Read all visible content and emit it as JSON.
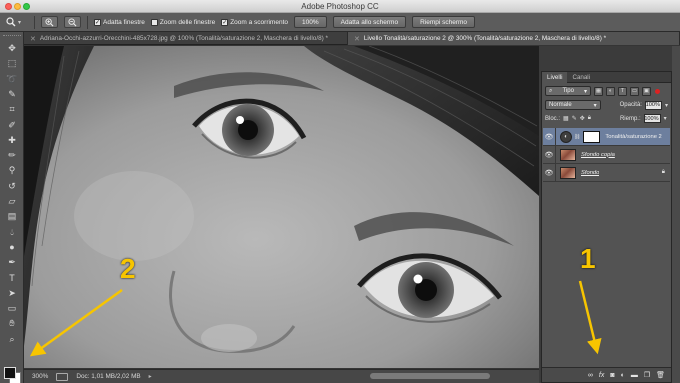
{
  "window": {
    "title": "Adobe Photoshop CC"
  },
  "options_bar": {
    "tool_icon": "zoom-icon",
    "zoom_in_icon": "zoom-in-icon",
    "zoom_out_icon": "zoom-out-icon",
    "checkboxes": [
      {
        "label": "Adatta finestre",
        "checked": true
      },
      {
        "label": "Zoom delle finestre",
        "checked": false
      },
      {
        "label": "Zoom a scorrimento",
        "checked": true
      }
    ],
    "buttons": [
      "100%",
      "Adatta allo schermo",
      "Riempi schermo"
    ]
  },
  "document_tabs": [
    {
      "label": "Adriana-Occhi-azzurri-Orecchini-485x728.jpg @ 100% (Tonalità/saturazione 2, Maschera di livello/8) *",
      "active": false
    },
    {
      "label": "Livello Tonalità/saturazione 2 @ 300% (Tonalità/saturazione 2, Maschera di livello/8) *",
      "active": true
    }
  ],
  "status_bar": {
    "zoom": "300%",
    "doc": "Doc: 1,01 MB/2,02 MB"
  },
  "layers_panel": {
    "tabs": [
      "Livelli",
      "Canali"
    ],
    "filter_label": "Tipo",
    "blend_mode": "Normale",
    "opacity_label": "Opacità:",
    "opacity_value": "100%",
    "lock_label": "Bloc.:",
    "fill_label": "Riemp.:",
    "fill_value": "100%",
    "layers": [
      {
        "name": "Tonalità/saturazione 2",
        "selected": true,
        "type": "adjustment"
      },
      {
        "name": "Sfondo copia",
        "selected": false,
        "type": "photo"
      },
      {
        "name": "Sfondo",
        "selected": false,
        "type": "photo",
        "locked": true
      }
    ],
    "footer_icons": [
      "link-icon",
      "fx-icon",
      "mask-icon",
      "adjustment-icon",
      "folder-icon",
      "new-layer-icon",
      "trash-icon"
    ],
    "footer_fx": "fx"
  },
  "annotations": {
    "one": "1",
    "two": "2",
    "color": "#f7c500"
  },
  "colors": {
    "foreground": "#111111",
    "background": "#ffffff",
    "selection": "#6d7f9e"
  }
}
